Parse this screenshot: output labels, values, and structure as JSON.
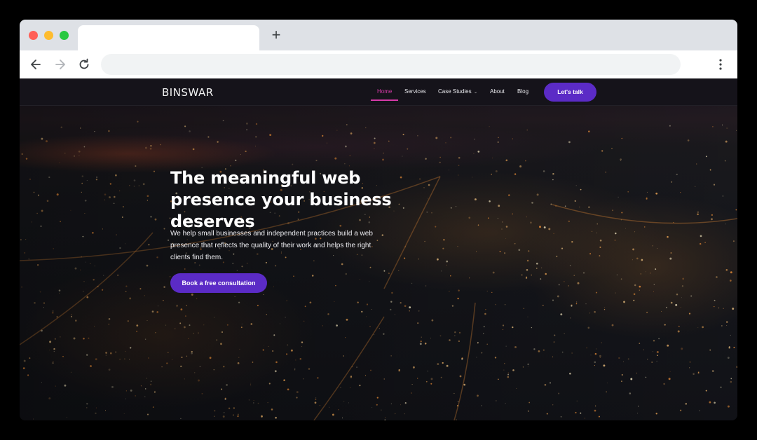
{
  "browser": {
    "tab_title": "",
    "new_tab_symbol": "+",
    "address": ""
  },
  "site": {
    "logo": "BINSWAR",
    "nav": {
      "home": "Home",
      "services": "Services",
      "case_studies": "Case Studies",
      "about": "About",
      "blog": "Blog",
      "cta": "Let's talk"
    },
    "hero": {
      "headline": "The meaningful web presence your business deserves",
      "subtext": "We help small businesses and independent practices build a web presence that reflects the quality of their work and helps the right clients find them.",
      "cta": "Book a free consultation"
    }
  },
  "colors": {
    "accent": "#5b2bc6",
    "active_nav": "#d63aa8",
    "navbar_bg": "#15131a"
  }
}
